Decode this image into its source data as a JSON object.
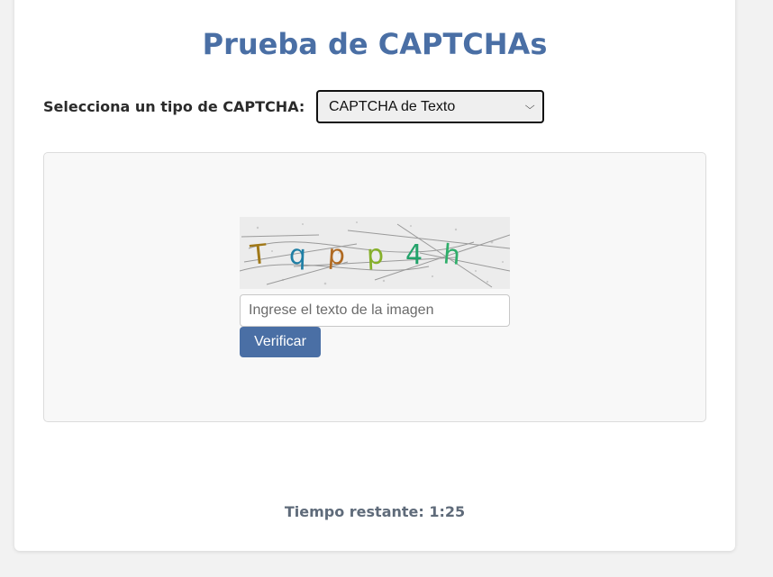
{
  "page": {
    "title": "Prueba de CAPTCHAs"
  },
  "selector": {
    "label": "Selecciona un tipo de CAPTCHA:",
    "selected": "CAPTCHA de Texto",
    "icon": "chevron-down-icon"
  },
  "captcha": {
    "characters": [
      "T",
      "q",
      "p",
      "p",
      "4",
      "h"
    ],
    "character_colors": [
      "#a07818",
      "#1f7fa5",
      "#b06a22",
      "#86b02a",
      "#23a26a",
      "#2fae6a"
    ],
    "input_placeholder": "Ingrese el texto de la imagen",
    "verify_label": "Verificar"
  },
  "timer": {
    "text": "Tiempo restante: 1:25"
  },
  "colors": {
    "accent": "#4a6fa5",
    "timer_text": "#5f6b7a"
  }
}
